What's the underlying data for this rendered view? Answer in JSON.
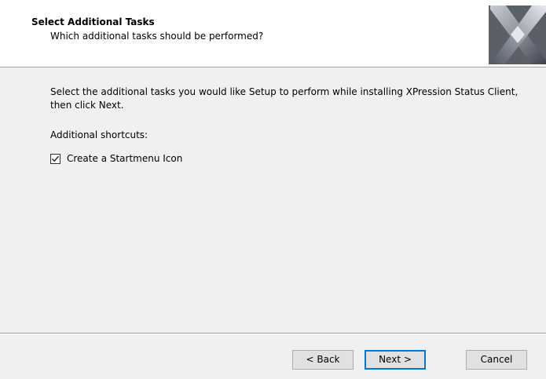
{
  "header": {
    "title": "Select Additional Tasks",
    "subtitle": "Which additional tasks should be performed?",
    "logo_icon": "xpression-x-logo"
  },
  "main": {
    "intro": "Select the additional tasks you would like Setup to perform while installing XPression Status Client, then click Next.",
    "shortcuts_label": "Additional shortcuts:",
    "tasks": [
      {
        "label": "Create a Startmenu Icon",
        "checked": true
      }
    ]
  },
  "footer": {
    "back_label": "< Back",
    "next_label": "Next >",
    "cancel_label": "Cancel"
  },
  "colors": {
    "accent": "#0078d7",
    "header_bg": "#ffffff",
    "body_bg": "#f0f0f0"
  }
}
